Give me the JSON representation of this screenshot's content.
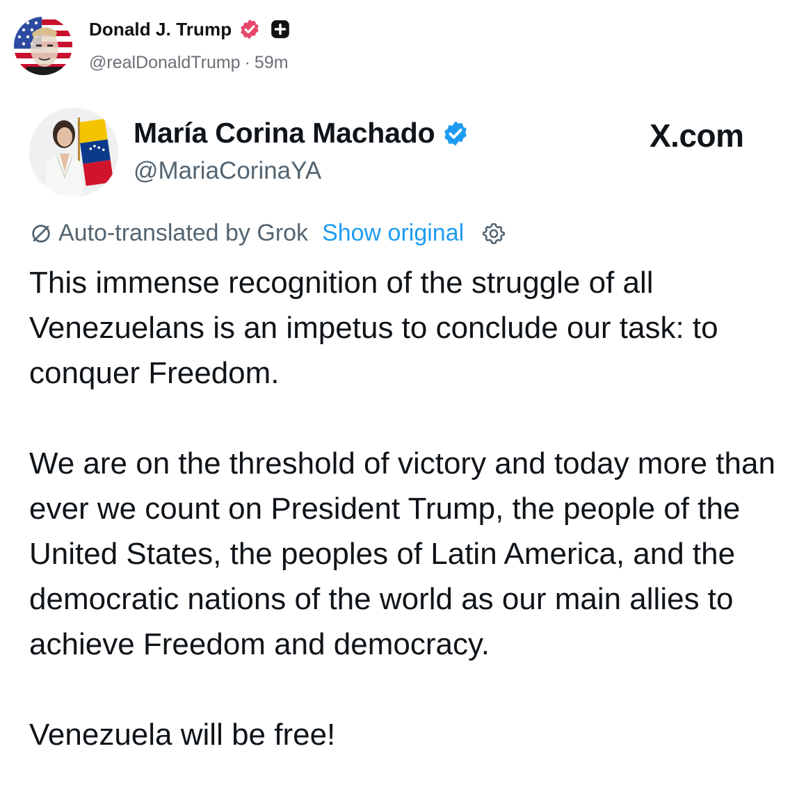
{
  "post": {
    "author_name": "Donald J. Trump",
    "author_handle": "@realDonaldTrump",
    "separator": "·",
    "timestamp": "59m",
    "avatar_icon": "avatar-portrait-flag",
    "verified_icon": "verified-badge-icon",
    "verified_color": "#e5476a",
    "plus_icon": "plus-badge-icon"
  },
  "embed": {
    "name": "María Corina Machado",
    "handle": "@MariaCorinaYA",
    "source": "X.com",
    "verified_color": "#1d9bf0",
    "translation": {
      "label": "Auto-translated by Grok",
      "show_original": "Show original",
      "icon_left": "not-translated-icon",
      "icon_right": "gear-icon"
    },
    "paragraphs": [
      "This immense recognition of the struggle of all Venezuelans is an impetus to conclude our task: to conquer Freedom.",
      "We are on the threshold of victory and today more than ever we count on President Trump, the people of the United States, the peoples of Latin America, and the democratic nations of the world as our main allies to achieve Freedom and democracy.",
      "Venezuela will be free!"
    ]
  }
}
